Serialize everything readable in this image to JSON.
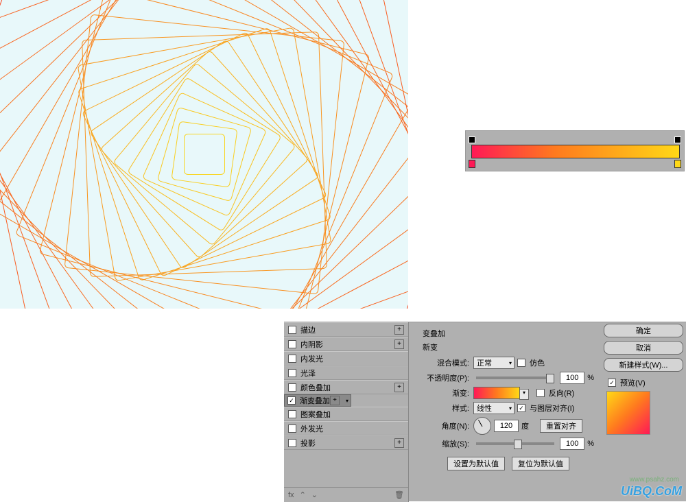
{
  "section": {
    "title": "变叠加",
    "sub": "新变"
  },
  "labels": {
    "blend": "混合模式:",
    "opacity": "不透明度(P):",
    "gradient": "渐变:",
    "style": "样式:",
    "angle": "角度(N):",
    "scale": "缩放(S):",
    "dither": "仿色",
    "reverse": "反向(R)",
    "align": "与图层对齐(I)",
    "deg": "度",
    "pct": "%"
  },
  "values": {
    "blend": "正常",
    "opacity": "100",
    "style": "线性",
    "angle": "120",
    "scale": "100",
    "align_checked": "✓"
  },
  "buttons": {
    "reset_align": "重置对齐",
    "set_default": "设置为默认值",
    "reset_default": "复位为默认值",
    "ok": "确定",
    "cancel": "取消",
    "new_style": "新建样式(W)...",
    "preview": "预览(V)"
  },
  "effects": [
    {
      "label": "描边",
      "checked": false,
      "plus": true
    },
    {
      "label": "内阴影",
      "checked": false,
      "plus": true
    },
    {
      "label": "内发光",
      "checked": false,
      "plus": false
    },
    {
      "label": "光泽",
      "checked": false,
      "plus": false
    },
    {
      "label": "颜色叠加",
      "checked": false,
      "plus": true
    },
    {
      "label": "渐变叠加",
      "checked": true,
      "plus": true,
      "selected": true
    },
    {
      "label": "图案叠加",
      "checked": false,
      "plus": false
    },
    {
      "label": "外发光",
      "checked": false,
      "plus": false
    },
    {
      "label": "投影",
      "checked": false,
      "plus": true
    }
  ],
  "footer": {
    "fx": "fx",
    "trash": "🗑"
  },
  "preview_checked": "✓",
  "watermark": "UiBQ.CoM",
  "watermark2": "www.psahz.com",
  "gradient_editor": {
    "stops": [
      {
        "pos": 0,
        "color": "#ff1956"
      },
      {
        "pos": 100,
        "color": "#ffd817"
      }
    ]
  }
}
